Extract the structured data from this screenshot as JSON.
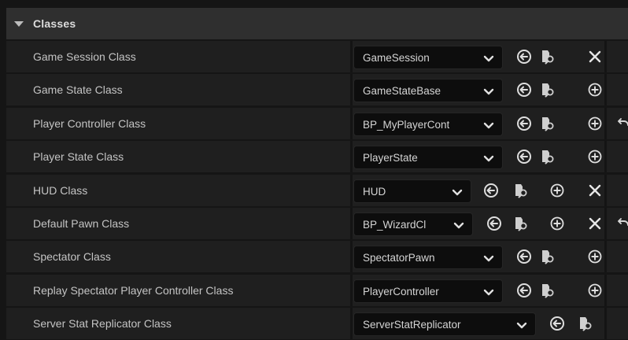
{
  "section": {
    "title": "Classes"
  },
  "rows": [
    {
      "label": "Game Session Class",
      "value": "GameSession"
    },
    {
      "label": "Game State Class",
      "value": "GameStateBase"
    },
    {
      "label": "Player Controller Class",
      "value": "BP_MyPlayerCont"
    },
    {
      "label": "Player State Class",
      "value": "PlayerState"
    },
    {
      "label": "HUD Class",
      "value": "HUD"
    },
    {
      "label": "Default Pawn Class",
      "value": "BP_WizardCl"
    },
    {
      "label": "Spectator Class",
      "value": "SpectatorPawn"
    },
    {
      "label": "Replay Spectator Player Controller Class",
      "value": "PlayerController"
    },
    {
      "label": "Server Stat Replicator Class",
      "value": "ServerStatReplicator"
    }
  ],
  "icons": {
    "dropdown": "chevron-down-icon",
    "use_selected": "use-selected-arrow-icon",
    "browse": "browse-to-asset-icon",
    "create": "create-new-plus-icon",
    "clear": "clear-x-icon",
    "reset": "reset-to-default-icon"
  },
  "colors": {
    "background": "#151515",
    "row": "#1f1f1f",
    "header": "#2f2f2f",
    "combo": "#0d0d0d",
    "text": "#c4c4c4"
  }
}
